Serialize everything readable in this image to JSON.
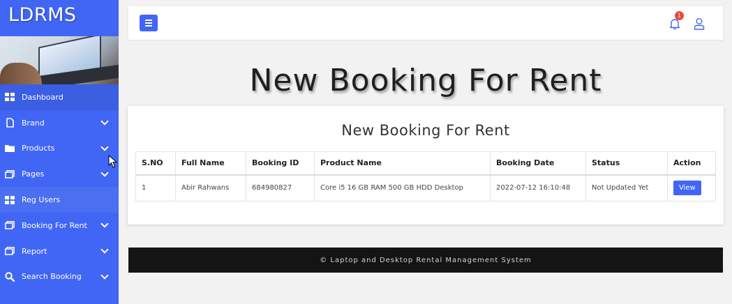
{
  "app": {
    "logo": "LDRMS"
  },
  "sidebar": {
    "items": [
      {
        "label": "Dashboard",
        "icon": "dashboard-icon",
        "has_chevron": false
      },
      {
        "label": "Brand",
        "icon": "file-icon",
        "has_chevron": true
      },
      {
        "label": "Products",
        "icon": "folder-icon",
        "has_chevron": true
      },
      {
        "label": "Pages",
        "icon": "windows-icon",
        "has_chevron": true
      },
      {
        "label": "Reg Users",
        "icon": "dashboard-icon",
        "has_chevron": false
      },
      {
        "label": "Booking For Rent",
        "icon": "windows-icon",
        "has_chevron": true
      },
      {
        "label": "Report",
        "icon": "windows-icon",
        "has_chevron": true
      },
      {
        "label": "Search Booking",
        "icon": "search-icon",
        "has_chevron": true
      }
    ]
  },
  "topbar": {
    "notification_count": "1"
  },
  "page": {
    "heading": "New Booking For Rent",
    "card_title": "New Booking For Rent"
  },
  "table": {
    "headers": [
      "S.NO",
      "Full Name",
      "Booking ID",
      "Product Name",
      "Booking Date",
      "Status",
      "Action"
    ],
    "rows": [
      {
        "sno": "1",
        "full_name": "Abir Rahwans",
        "booking_id": "684980827",
        "product_name": "Core i5 16 GB RAM 500 GB HDD Desktop",
        "booking_date": "2022-07-12 16:10:48",
        "status": "Not Updated Yet",
        "action": "View"
      }
    ]
  },
  "footer": {
    "text": "© Laptop and Desktop Rental Management System"
  },
  "colors": {
    "primary": "#4166f5",
    "footer_bg": "#141414",
    "badge": "#e74c3c"
  }
}
